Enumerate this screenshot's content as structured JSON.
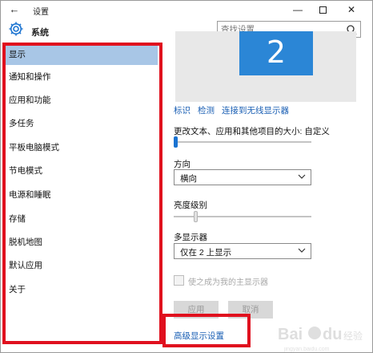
{
  "window": {
    "title": "设置",
    "back_glyph": "←",
    "min_glyph": "—",
    "close_glyph": "✕"
  },
  "header": {
    "section_title": "系统",
    "search_placeholder": "查找设置"
  },
  "sidebar": {
    "items": [
      {
        "label": "显示",
        "selected": true
      },
      {
        "label": "通知和操作"
      },
      {
        "label": "应用和功能"
      },
      {
        "label": "多任务"
      },
      {
        "label": "平板电脑模式"
      },
      {
        "label": "节电模式"
      },
      {
        "label": "电源和睡眠"
      },
      {
        "label": "存储"
      },
      {
        "label": "脱机地图"
      },
      {
        "label": "默认应用"
      },
      {
        "label": "关于"
      }
    ]
  },
  "main": {
    "monitor_number": "2",
    "links": {
      "identify": "标识",
      "detect": "检测",
      "connect_wireless": "连接到无线显示器"
    },
    "scale": {
      "label": "更改文本、应用和其他项目的大小: 自定义",
      "level": 0.0
    },
    "orientation": {
      "label": "方向",
      "value": "横向"
    },
    "brightness": {
      "label": "亮度级别",
      "level": 0.15
    },
    "multi_display": {
      "label": "多显示器",
      "value": "仅在 2 上显示"
    },
    "make_main_label": "使之成为我的主显示器",
    "apply_label": "应用",
    "cancel_label": "取消",
    "advanced_link": "高级显示设置"
  },
  "colors": {
    "accent": "#1a73d1",
    "selection": "#a8c6e6",
    "highlight_border": "#e0101e",
    "link": "#1a5fb4"
  },
  "icons": {
    "back": "back-arrow-icon",
    "settings": "gear-icon",
    "search": "search-icon",
    "chevron": "chevron-down-icon"
  },
  "watermark": "Baidu经验"
}
